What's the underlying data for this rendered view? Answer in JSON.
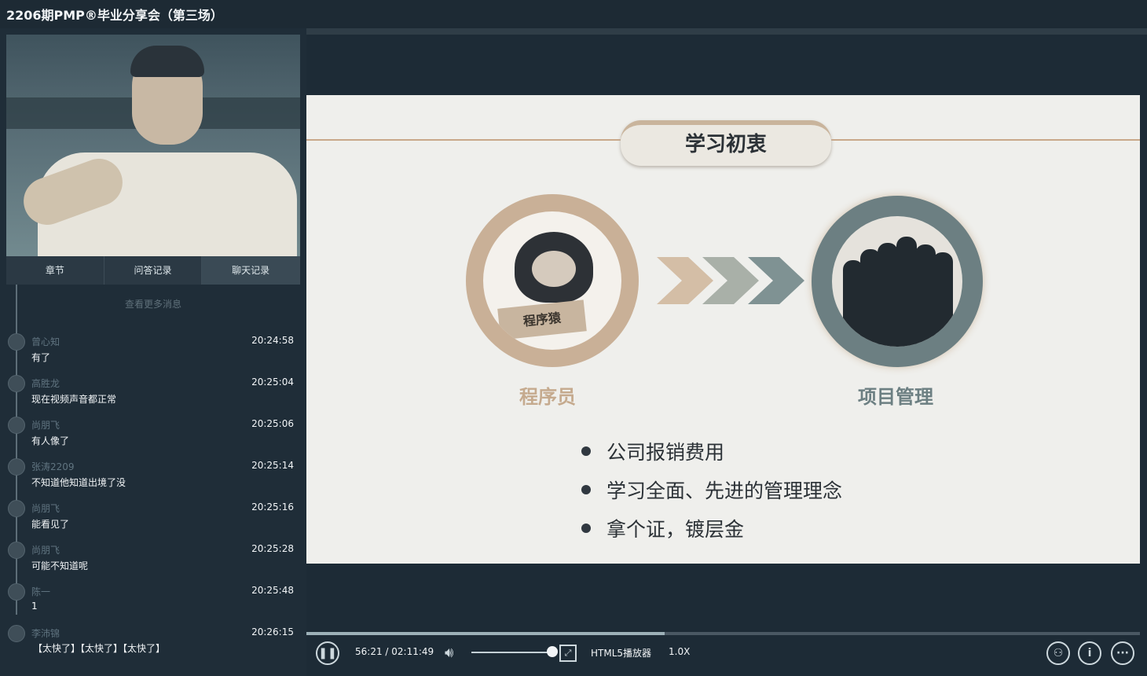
{
  "window": {
    "title": "2206期PMP®毕业分享会（第三场）"
  },
  "tabs": [
    {
      "label": "章节"
    },
    {
      "label": "问答记录"
    },
    {
      "label": "聊天记录"
    }
  ],
  "chat": {
    "more_label": "查看更多消息",
    "messages": [
      {
        "name": "曾心知",
        "time": "20:24:58",
        "text": "有了"
      },
      {
        "name": "高胜龙",
        "time": "20:25:04",
        "text": "现在视频声音都正常"
      },
      {
        "name": "尚朋飞",
        "time": "20:25:06",
        "text": "有人像了"
      },
      {
        "name": "张涛2209",
        "time": "20:25:14",
        "text": "不知道他知道出境了没"
      },
      {
        "name": "尚朋飞",
        "time": "20:25:16",
        "text": "能看见了"
      },
      {
        "name": "尚朋飞",
        "time": "20:25:28",
        "text": "可能不知道呢"
      },
      {
        "name": "陈一",
        "time": "20:25:48",
        "text": "1"
      },
      {
        "name": "李沛锦",
        "time": "20:26:15",
        "text": "【太快了】【太快了】【太快了】"
      }
    ]
  },
  "slide": {
    "title": "学习初衷",
    "sign_text": "程序猿",
    "left_label": "程序员",
    "right_label": "项目管理",
    "bullets": [
      "公司报销费用",
      "学习全面、先进的管理理念",
      "拿个证，镀层金"
    ],
    "colors": {
      "tan": "#c9b097",
      "slate": "#6c7f82",
      "chevron1": "#d4bea6",
      "chevron2": "#a9b0a8",
      "chevron3": "#7f9293"
    }
  },
  "player": {
    "time_display": "56:21 / 02:11:49",
    "progress_fraction": 0.43,
    "volume_fraction": 1.0,
    "player_label": "HTML5播放器",
    "speed": "1.0X",
    "icons": [
      "pause-icon",
      "volume-icon",
      "pip-icon",
      "feedback-icon",
      "info-icon",
      "more-icon"
    ]
  }
}
